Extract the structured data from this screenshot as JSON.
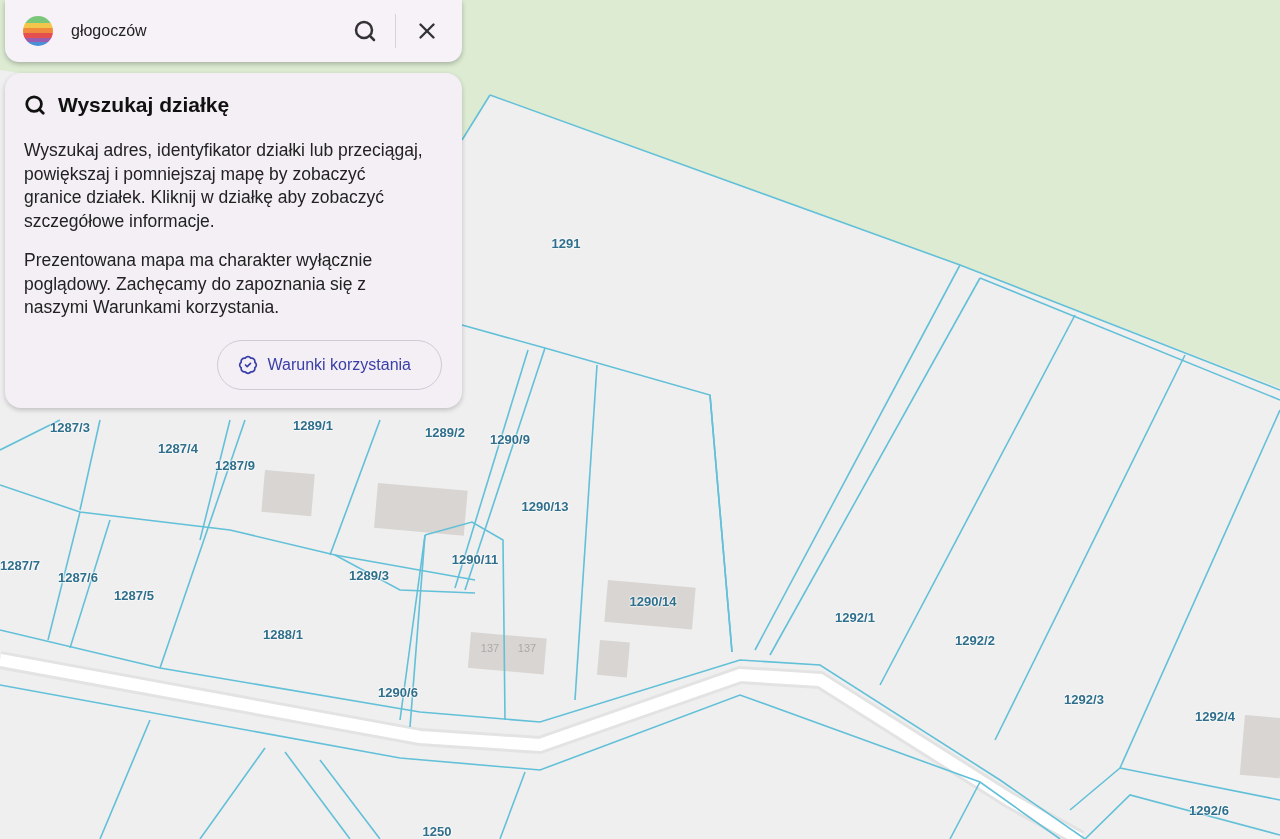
{
  "search": {
    "value": "głogoczów"
  },
  "info_panel": {
    "title": "Wyszukaj działkę",
    "paragraphs": [
      "Wyszukaj adres, identyfikator działki lub przeciągaj, powiększaj i pomniejszaj mapę by zobaczyć granice działek. Kliknij w działkę aby zobaczyć szczegółowe informacje.",
      "Prezentowana mapa ma charakter wyłącznie poglądowy. Zachęcamy do zapoznania się z naszymi Warunkami korzystania."
    ],
    "terms_button": "Warunki korzystania"
  },
  "map": {
    "parcel_labels": [
      "1291",
      "1287/3",
      "1287/4",
      "1287/9",
      "1289/1",
      "1289/2",
      "1290/9",
      "1290/13",
      "1290/11",
      "1289/3",
      "1287/7",
      "1287/6",
      "1287/5",
      "1288/1",
      "1290/14",
      "1292/1",
      "1292/2",
      "1292/3",
      "1292/4",
      "1292/6",
      "1290/6",
      "1250"
    ],
    "building_numbers": [
      "137",
      "137"
    ]
  }
}
